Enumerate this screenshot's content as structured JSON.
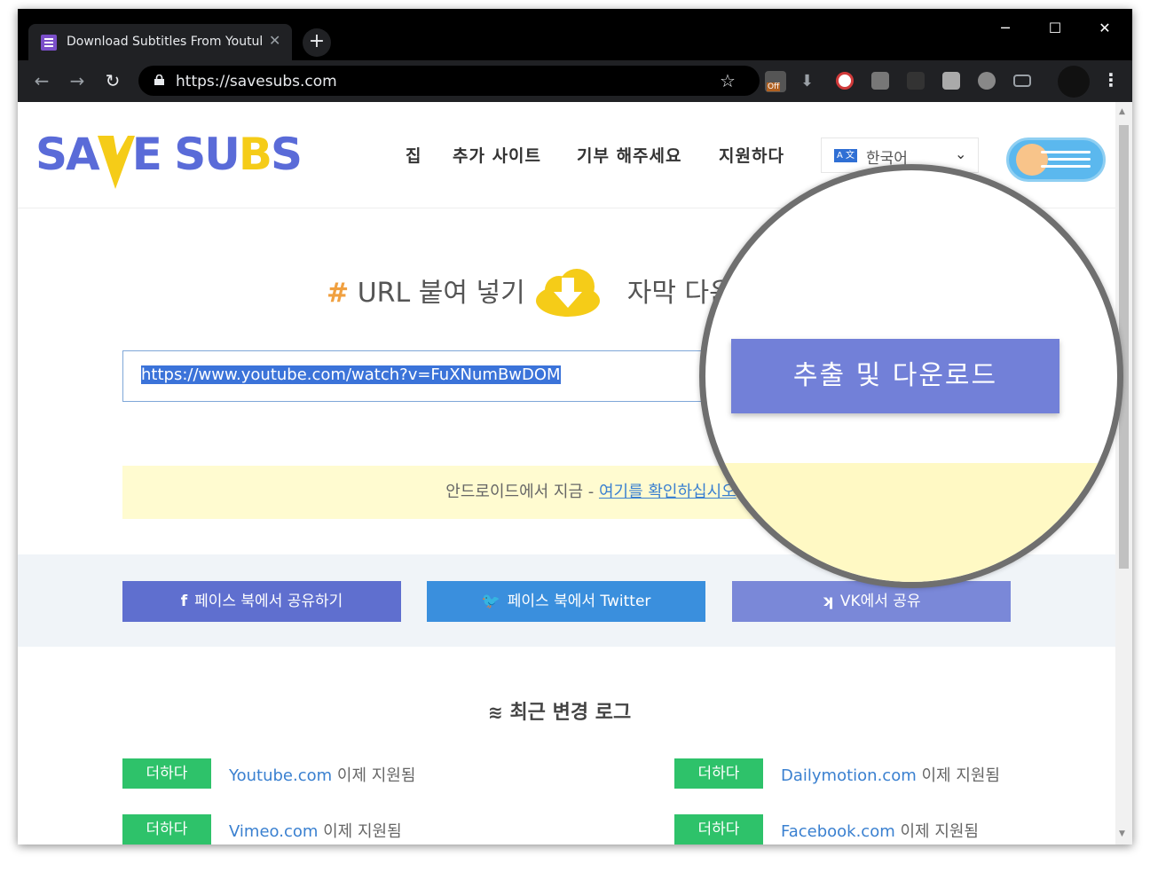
{
  "browser": {
    "tab_title": "Download Subtitles From Youtube",
    "url": "https://savesubs.com",
    "new_tab": "+",
    "minimize": "─",
    "maximize": "☐",
    "close": "✕",
    "back": "←",
    "forward": "→",
    "reload": "↻",
    "tab_close": "✕",
    "bookmark": "☆",
    "menu": "⋮",
    "ext_off_label": "Off"
  },
  "site": {
    "logo_left": "SA",
    "logo_right_a": "E SU",
    "logo_right_b": "B",
    "logo_right_c": "S",
    "nav": [
      "집",
      "추가 사이트",
      "기부 해주세요",
      "지원하다"
    ],
    "language": "한국어",
    "lang_flag": "A 文",
    "hero_hash": "#",
    "hero_part1": "URL 붙여 넣기",
    "hero_part2": "자막 다운",
    "url_value": "https://www.youtube.com/watch?v=FuXNumBwDOM",
    "extract_button": "추출 및 다운로드",
    "android_text": "안드로이드에서 지금 - ",
    "android_link": "여기를 확인하십시오",
    "share": {
      "facebook": "페이스 북에서 공유하기",
      "twitter": "페이스 북에서 Twitter",
      "vk": "VK에서 공유"
    },
    "changelog_title": "최근 변경 로그",
    "badge": "더하다",
    "changelog": [
      {
        "site": "Youtube.com",
        "text": " 이제 지원됨"
      },
      {
        "site": "Dailymotion.com",
        "text": " 이제 지원됨"
      },
      {
        "site": "Vimeo.com",
        "text": " 이제 지원됨"
      },
      {
        "site": "Facebook.com",
        "text": " 이제 지원됨"
      }
    ]
  },
  "colors": {
    "accent": "#7280d8",
    "facebook": "#5f6fcf",
    "twitter": "#3a8fdd",
    "vk": "#7a88d8",
    "badge": "#2ec26a",
    "link": "#3a80d0"
  }
}
